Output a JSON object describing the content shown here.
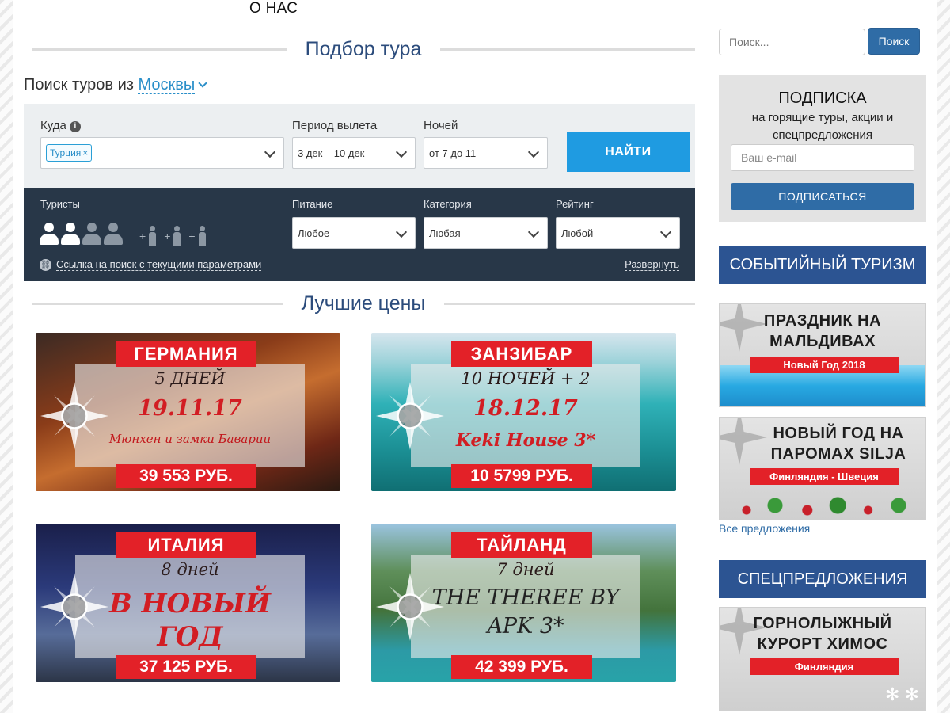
{
  "nav": {
    "about": "О НАС"
  },
  "tour_pick": {
    "title": "Подбор тура"
  },
  "search_from": {
    "prefix": "Поиск туров из",
    "city": "Москвы"
  },
  "form": {
    "where_label": "Куда",
    "where_tag": "Турция",
    "where_tag_remove": "×",
    "period_label": "Период вылета",
    "period_value": "3 дек – 10 дек",
    "nights_label": "Ночей",
    "nights_value": "от 7 до 11",
    "find_button": "НАЙТИ",
    "tourists_label": "Туристы",
    "meal_label": "Питание",
    "meal_value": "Любое",
    "category_label": "Категория",
    "category_value": "Любая",
    "rating_label": "Рейтинг",
    "rating_value": "Любой",
    "search_link": "Ссылка на поиск с текущими параметрами",
    "expand_link": "Развернуть"
  },
  "best_prices": {
    "title": "Лучшие цены",
    "promos": [
      {
        "title": "ГЕРМАНИЯ",
        "line1": "5 ДНЕЙ",
        "line2": "19.11.17",
        "line3": "Мюнхен и замки Баварии",
        "price": "39 553 РУБ."
      },
      {
        "title": "ЗАНЗИБАР",
        "line1": "10 НОЧЕЙ + 2",
        "line2": "18.12.17",
        "line3": "Keki House 3*",
        "price": "10 5799 РУБ."
      },
      {
        "title": "ИТАЛИЯ",
        "line1": "8 дней",
        "line2": "В НОВЫЙ ГОД",
        "price": "37 125 РУБ."
      },
      {
        "title": "ТАЙЛАНД",
        "line1": "7 дней",
        "line2": "THE THEREE BY APK 3*",
        "price": "42 399 РУБ."
      }
    ]
  },
  "sidebar": {
    "search_placeholder": "Поиск...",
    "search_button": "Поиск",
    "subscribe": {
      "title": "ПОДПИСКА",
      "desc": "на горящие туры, акции и спецпредложения",
      "email_placeholder": "Ваш e-mail",
      "button": "ПОДПИСАТЬСЯ"
    },
    "event_tourism": {
      "header": "СОБЫТИЙНЫЙ ТУРИЗМ",
      "banners": [
        {
          "title": "ПРАЗДНИК НА МАЛЬДИВАХ",
          "ribbon": "Новый Год 2018"
        },
        {
          "title": "НОВЫЙ ГОД НА ПАРОМАХ SILJA",
          "ribbon": "Финляндия - Швеция"
        }
      ],
      "all_offers": "Все предложения"
    },
    "special": {
      "header": "СПЕЦПРЕДЛОЖЕНИЯ",
      "banners": [
        {
          "title": "ГОРНОЛЫЖНЫЙ КУРОРТ ХИМОС",
          "ribbon": "Финляндия"
        }
      ]
    }
  },
  "colors": {
    "accent": "#1f9be1",
    "dark_panel": "#283748",
    "header_blue": "#2c5492",
    "promo_red": "#e32128"
  }
}
